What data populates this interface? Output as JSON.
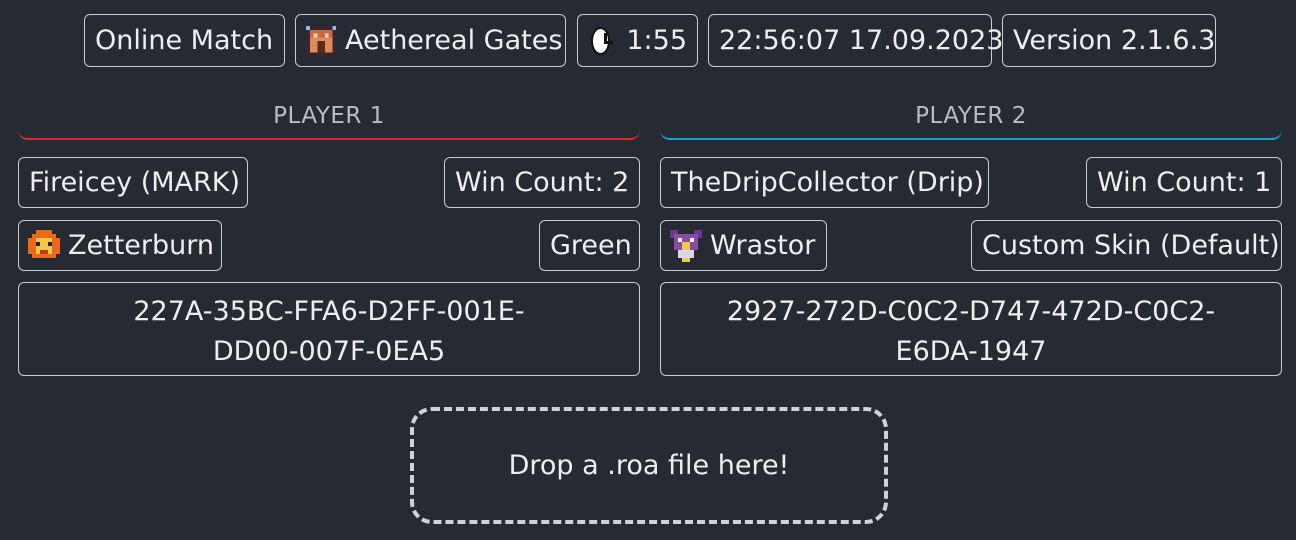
{
  "top_bar": {
    "match_type": "Online Match",
    "stage": "Aethereal Gates",
    "stage_icon": "stage-thumbnail-icon",
    "duration": "1:55",
    "timestamp": "22:56:07 17.09.2023",
    "version": "Version 2.1.6.3"
  },
  "player1": {
    "header": "PLAYER 1",
    "accent_color": "#d92b2b",
    "name": "Fireicey (MARK)",
    "win_count": "Win Count: 2",
    "character": "Zetterburn",
    "character_icon": "zetterburn-icon",
    "skin": "Green",
    "code_line1": "227A-35BC-FFA6-D2FF-001E-",
    "code_line2": "DD00-007F-0EA5"
  },
  "player2": {
    "header": "PLAYER 2",
    "accent_color": "#12a8d6",
    "name": "TheDripCollector (Drip)",
    "win_count": "Win Count: 1",
    "character": "Wrastor",
    "character_icon": "wrastor-icon",
    "skin": "Custom Skin (Default)",
    "code_line1": "2927-272D-C0C2-D747-472D-C0C2-",
    "code_line2": "E6DA-1947"
  },
  "dropzone": {
    "label": "Drop a .roa file here!"
  }
}
